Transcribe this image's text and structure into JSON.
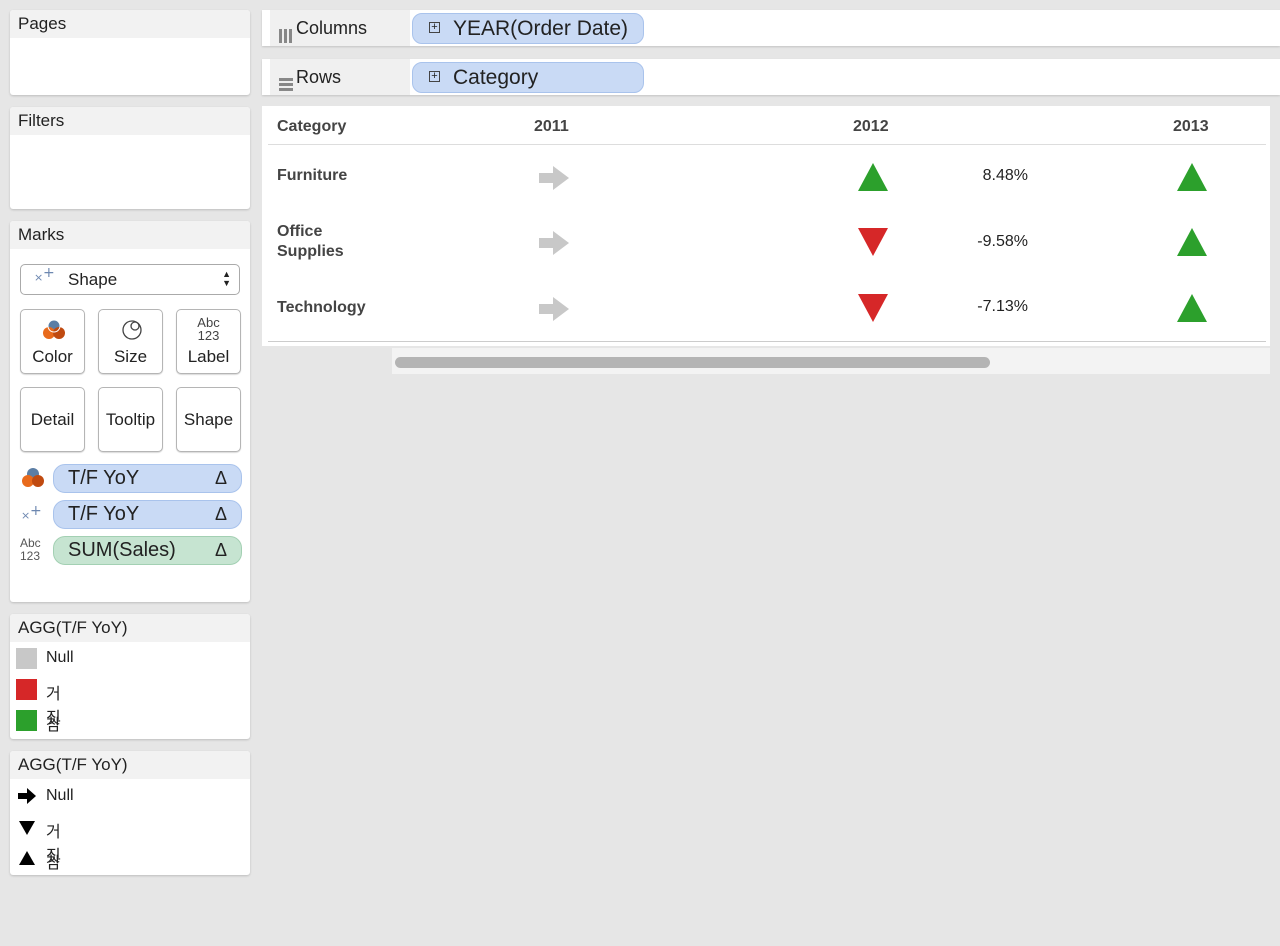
{
  "sidebar": {
    "pages_title": "Pages",
    "filters_title": "Filters",
    "marks": {
      "title": "Marks",
      "mark_type": "Shape",
      "buttons": [
        {
          "label": "Color",
          "icon": "color-icon"
        },
        {
          "label": "Size",
          "icon": "size-icon"
        },
        {
          "label": "Label",
          "icon": "label-icon",
          "icon_text_top": "Abc",
          "icon_text_bottom": "123"
        },
        {
          "label": "Detail"
        },
        {
          "label": "Tooltip"
        },
        {
          "label": "Shape"
        }
      ],
      "pills": [
        {
          "label": "T/F YoY",
          "delta": "Δ",
          "encoding_icon": "color-icon",
          "color": "blue"
        },
        {
          "label": "T/F YoY",
          "delta": "Δ",
          "encoding_icon": "shape-icon",
          "color": "blue"
        },
        {
          "label": "SUM(Sales)",
          "delta": "Δ",
          "encoding_icon": "label-icon",
          "color": "green"
        }
      ],
      "label_icon_top": "Abc",
      "label_icon_bottom": "123"
    },
    "color_legend": {
      "title": "AGG(T/F YoY)",
      "items": [
        {
          "label": "Null",
          "color": "#c8c8c8"
        },
        {
          "label": "거짓",
          "color": "#d62728"
        },
        {
          "label": "참",
          "color": "#2ca02c"
        }
      ]
    },
    "shape_legend": {
      "title": "AGG(T/F YoY)",
      "items": [
        {
          "label": "Null",
          "shape": "arrow-right"
        },
        {
          "label": "거짓",
          "shape": "triangle-down"
        },
        {
          "label": "참",
          "shape": "triangle-up"
        }
      ]
    }
  },
  "shelves": {
    "columns": {
      "name": "Columns",
      "pill": "YEAR(Order Date)"
    },
    "rows": {
      "name": "Rows",
      "pill": "Category"
    }
  },
  "view": {
    "headers": {
      "category": "Category",
      "years": [
        "2011",
        "2012",
        "2013"
      ]
    },
    "rows": [
      {
        "category_line1": "Furniture",
        "category_line2": "",
        "marks": [
          "arrow-right",
          "triangle-up",
          "triangle-up"
        ],
        "pct_2012": "8.48%"
      },
      {
        "category_line1": "Office",
        "category_line2": "Supplies",
        "marks": [
          "arrow-right",
          "triangle-down",
          "triangle-up"
        ],
        "pct_2012": "-9.58%"
      },
      {
        "category_line1": "Technology",
        "category_line2": "",
        "marks": [
          "arrow-right",
          "triangle-down",
          "triangle-up"
        ],
        "pct_2012": "-7.13%"
      }
    ]
  },
  "colors": {
    "null": "#c8c8c8",
    "false": "#d62728",
    "true": "#2ca02c",
    "pill_blue": "#c9daf5",
    "pill_green": "#c6e4d1"
  }
}
